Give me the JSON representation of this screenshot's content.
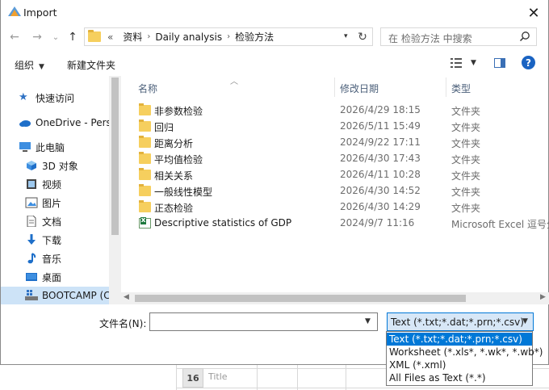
{
  "background_sheet": {
    "row_number": "16",
    "cell_text": "Title"
  },
  "dialog": {
    "title": "Import",
    "close_symbol": "✕"
  },
  "nav": {
    "back_symbol": "←",
    "forward_symbol": "→",
    "history_symbol": "⌄",
    "up_symbol": "↑",
    "breadcrumb_overflow": "«",
    "breadcrumb": [
      "资料",
      "Daily analysis",
      "检验方法"
    ],
    "refresh_symbol": "↻",
    "search_placeholder": "在 检验方法 中搜索"
  },
  "toolbar": {
    "organize": "组织",
    "new_folder": "新建文件夹",
    "help": "?"
  },
  "sidebar": {
    "items": [
      {
        "label": "快速访问",
        "icon": "quick-access-pin-icon"
      },
      {
        "label": "OneDrive - Perso",
        "icon": "onedrive-cloud-icon"
      },
      {
        "label": "此电脑",
        "icon": "this-pc-icon"
      },
      {
        "label": "3D 对象",
        "icon": "3d-objects-icon"
      },
      {
        "label": "视频",
        "icon": "videos-icon"
      },
      {
        "label": "图片",
        "icon": "pictures-icon"
      },
      {
        "label": "文档",
        "icon": "documents-icon"
      },
      {
        "label": "下载",
        "icon": "downloads-icon"
      },
      {
        "label": "音乐",
        "icon": "music-icon"
      },
      {
        "label": "桌面",
        "icon": "desktop-icon"
      },
      {
        "label": "BOOTCAMP (C",
        "icon": "drive-icon"
      }
    ]
  },
  "columns": {
    "name": "名称",
    "date": "修改日期",
    "type": "类型"
  },
  "files": [
    {
      "name": "非参数检验",
      "date": "2026/4/29 18:15",
      "type": "文件夹",
      "icon": "folder-icon"
    },
    {
      "name": "回归",
      "date": "2026/5/11 15:49",
      "type": "文件夹",
      "icon": "folder-icon"
    },
    {
      "name": "距离分析",
      "date": "2024/9/22 17:11",
      "type": "文件夹",
      "icon": "folder-icon"
    },
    {
      "name": "平均值检验",
      "date": "2026/4/30 17:43",
      "type": "文件夹",
      "icon": "folder-icon"
    },
    {
      "name": "相关关系",
      "date": "2026/4/11 10:28",
      "type": "文件夹",
      "icon": "folder-icon"
    },
    {
      "name": "一般线性模型",
      "date": "2026/4/30 14:52",
      "type": "文件夹",
      "icon": "folder-icon"
    },
    {
      "name": "正态检验",
      "date": "2026/4/30 14:29",
      "type": "文件夹",
      "icon": "folder-icon"
    },
    {
      "name": "Descriptive statistics of GDP",
      "date": "2024/9/7 11:16",
      "type": "Microsoft Excel 逗号分",
      "icon": "excel-csv-icon"
    }
  ],
  "filename": {
    "label": "文件名(N):",
    "value": ""
  },
  "filetype": {
    "selected": "Text (*.txt;*.dat;*.prn;*.csv)",
    "options": [
      "Text (*.txt;*.dat;*.prn;*.csv)",
      "Worksheet (*.xls*, *.wk*, *.wb*)",
      "XML (*.xml)",
      "All Files as Text (*.*)"
    ]
  }
}
